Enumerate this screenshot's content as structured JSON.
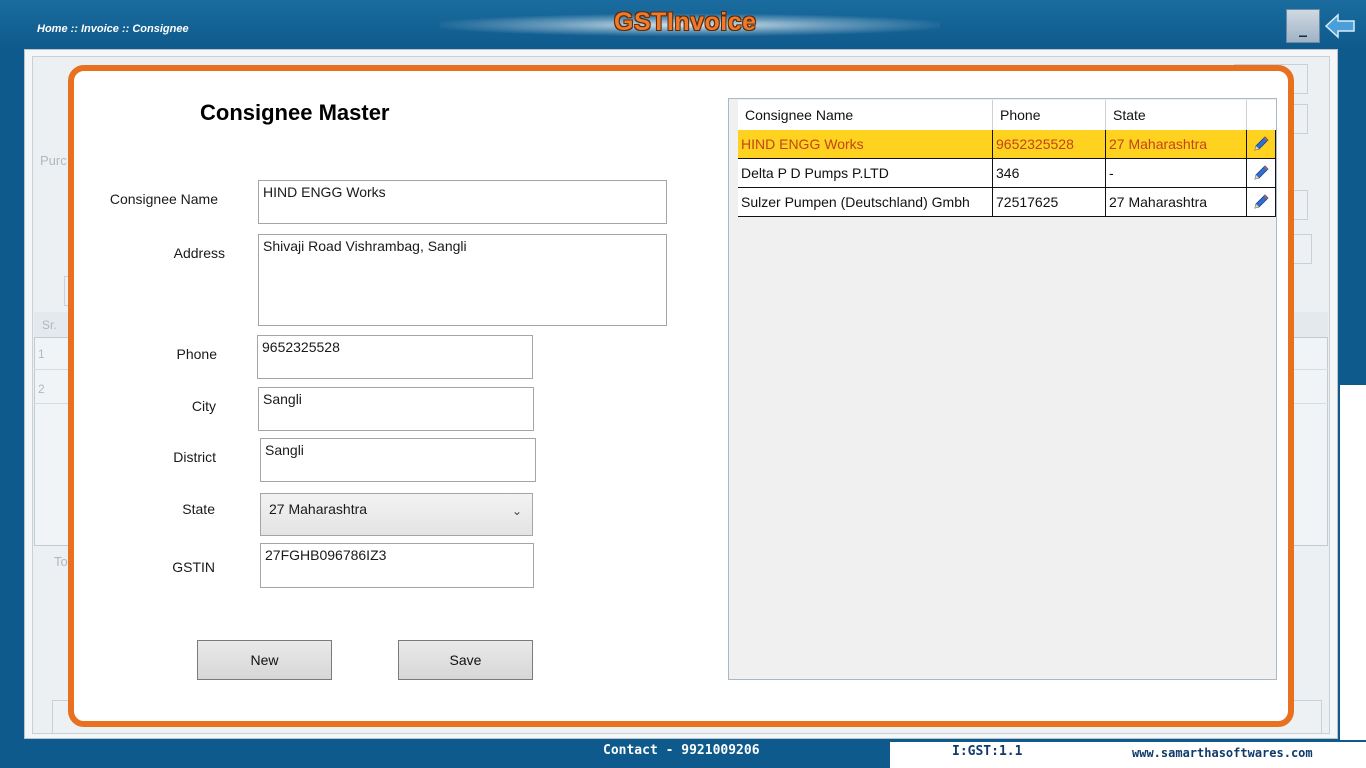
{
  "header": {
    "breadcrumb": "Home :: Invoice :: Consignee",
    "app_title": "GSTInvoice",
    "minimize_label": "_"
  },
  "background": {
    "purchase_label": "Purc",
    "sr_label": "Sr.",
    "row1": "1",
    "row2": "2",
    "total_label": "To"
  },
  "form": {
    "title": "Consignee Master",
    "fields": {
      "consignee_name": {
        "label": "Consignee Name",
        "value": "HIND ENGG Works"
      },
      "address": {
        "label": "Address",
        "value": "Shivaji Road Vishrambag, Sangli"
      },
      "phone": {
        "label": "Phone",
        "value": "9652325528"
      },
      "city": {
        "label": "City",
        "value": "Sangli"
      },
      "district": {
        "label": "District",
        "value": "Sangli"
      },
      "state": {
        "label": "State",
        "value": "27 Maharashtra"
      },
      "gstin": {
        "label": "GSTIN",
        "value": "27FGHB096786IZ3"
      }
    },
    "buttons": {
      "new": "New",
      "save": "Save"
    }
  },
  "grid": {
    "columns": [
      "Consignee Name",
      "Phone",
      "State"
    ],
    "rows": [
      {
        "name": "HIND ENGG Works",
        "phone": "9652325528",
        "state": "27 Maharashtra",
        "selected": true
      },
      {
        "name": "Delta P D Pumps P.LTD",
        "phone": "346",
        "state": "-",
        "selected": false
      },
      {
        "name": "Sulzer Pumpen (Deutschland) Gmbh",
        "phone": "72517625",
        "state": "27 Maharashtra",
        "selected": false
      }
    ]
  },
  "footer": {
    "contact": "Contact - 9921009206",
    "version": "I:GST:1.1",
    "website": "www.samarthasoftwares.com"
  },
  "colors": {
    "accent": "#e8701f",
    "header_blue": "#0f5a8c",
    "selected_row": "#ffd21f"
  }
}
